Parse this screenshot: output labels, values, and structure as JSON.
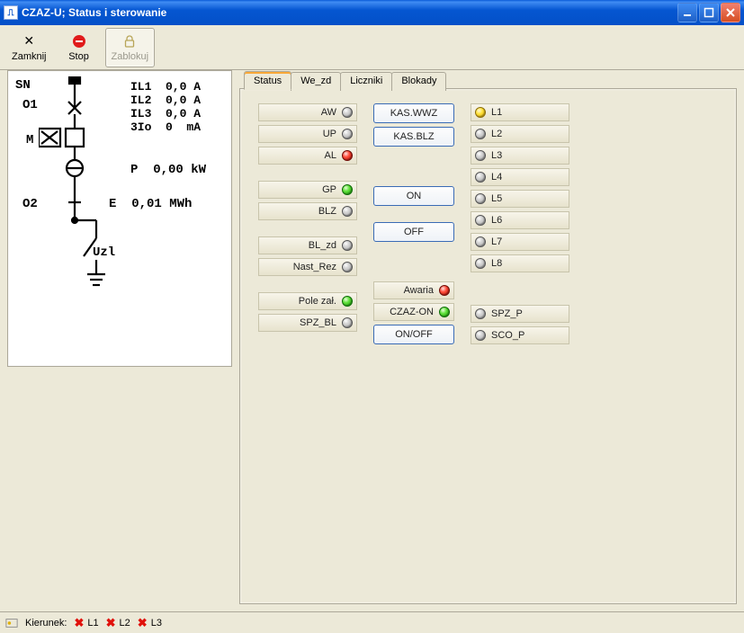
{
  "window": {
    "title": "CZAZ-U; Status i sterowanie"
  },
  "toolbar": {
    "close": "Zamknij",
    "stop": "Stop",
    "lock": "Zablokuj"
  },
  "tabs": {
    "status": "Status",
    "we_zd": "We_zd",
    "liczniki": "Liczniki",
    "blokady": "Blokady"
  },
  "diagram": {
    "sn": "SN",
    "o1": "O1",
    "m": "M",
    "o2": "O2",
    "uzl": "Uzl",
    "measurements": "IL1  0,0 A\nIL2  0,0 A\nIL3  0,0 A\n3Io  0  mA",
    "p_line": "P  0,00 kW",
    "e_line": "E  0,01 MWh"
  },
  "status": {
    "col1": {
      "aw": "AW",
      "up": "UP",
      "al": "AL",
      "gp": "GP",
      "blz": "BLZ",
      "bl_zd": "BL_zd",
      "nast_rez": "Nast_Rez",
      "pole_zal": "Pole zał.",
      "spz_bl": "SPZ_BL"
    },
    "col2": {
      "kas_wwz": "KAS.WWZ",
      "kas_blz": "KAS.BLZ",
      "on": "ON",
      "off": "OFF",
      "awaria": "Awaria",
      "czaz_on": "CZAZ-ON",
      "on_off": "ON/OFF"
    },
    "col3": {
      "l1": "L1",
      "l2": "L2",
      "l3": "L3",
      "l4": "L4",
      "l5": "L5",
      "l6": "L6",
      "l7": "L7",
      "l8": "L8",
      "spz_p": "SPZ_P",
      "sco_p": "SCO_P"
    }
  },
  "statusbar": {
    "kierunek": "Kierunek:",
    "l1": "L1",
    "l2": "L2",
    "l3": "L3"
  }
}
